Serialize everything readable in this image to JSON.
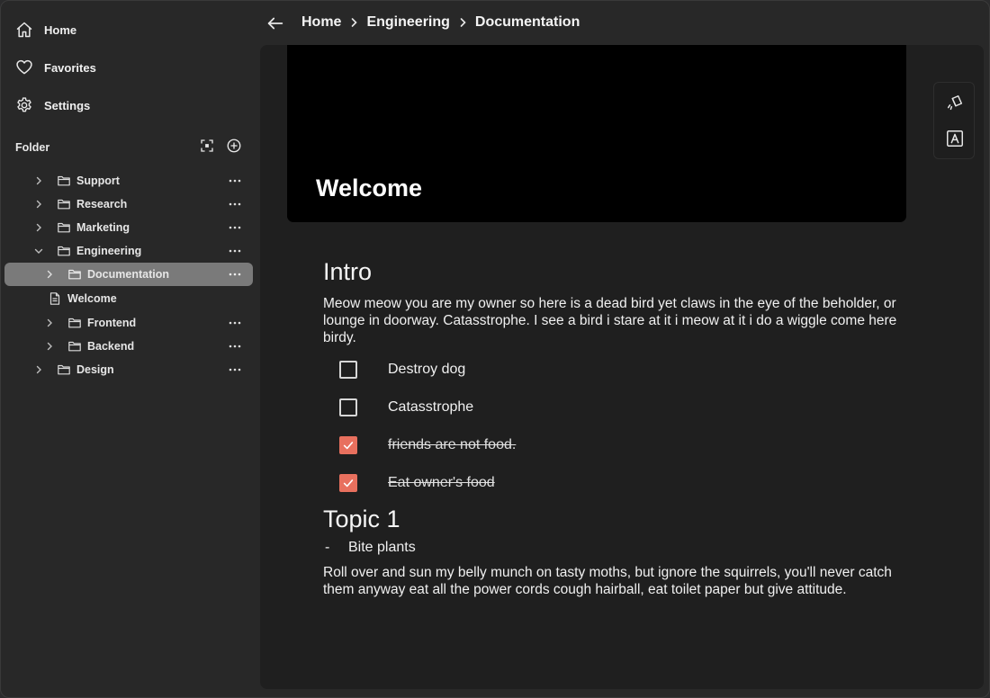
{
  "nav": {
    "home": "Home",
    "favorites": "Favorites",
    "settings": "Settings"
  },
  "folder": {
    "header": "Folder",
    "items": [
      {
        "label": "Support"
      },
      {
        "label": "Research"
      },
      {
        "label": "Marketing"
      },
      {
        "label": "Engineering"
      },
      {
        "label": "Documentation"
      },
      {
        "label": "Welcome"
      },
      {
        "label": "Frontend"
      },
      {
        "label": "Backend"
      },
      {
        "label": "Design"
      }
    ]
  },
  "breadcrumb": [
    "Home",
    "Engineering",
    "Documentation"
  ],
  "page": {
    "cover_title": "Welcome",
    "sections": [
      {
        "heading": "Intro",
        "paragraph": "Meow meow you are my owner so here is a dead bird yet claws in the eye of the beholder, or lounge in doorway. Catasstrophe.  I see a bird i stare at it i meow at it i do a wiggle come here birdy.",
        "todos": [
          {
            "text": "Destroy dog",
            "checked": false
          },
          {
            "text": "Catasstrophe",
            "checked": false
          },
          {
            "text": "friends are not food.",
            "checked": true
          },
          {
            "text": "Eat owner's food",
            "checked": true
          }
        ]
      },
      {
        "heading": "Topic 1",
        "bullet": "Bite plants",
        "paragraph": "Roll over and sun my belly munch on tasty moths, but ignore the squirrels, you'll never catch them anyway eat all the power cords cough hairball, eat toilet paper but give attitude."
      }
    ]
  },
  "colors": {
    "accent": "#e8705e",
    "selected": "#7a7a7a",
    "panel": "#1f1f1f",
    "sidebar": "#282828"
  },
  "icons": [
    "home-icon",
    "heart-icon",
    "gear-icon",
    "focus-icon",
    "add-circle-icon",
    "folder-icon",
    "document-icon",
    "chevron-right-icon",
    "chevron-down-icon",
    "more-icon",
    "arrow-left-icon",
    "paint-icon",
    "font-icon",
    "check-icon"
  ]
}
